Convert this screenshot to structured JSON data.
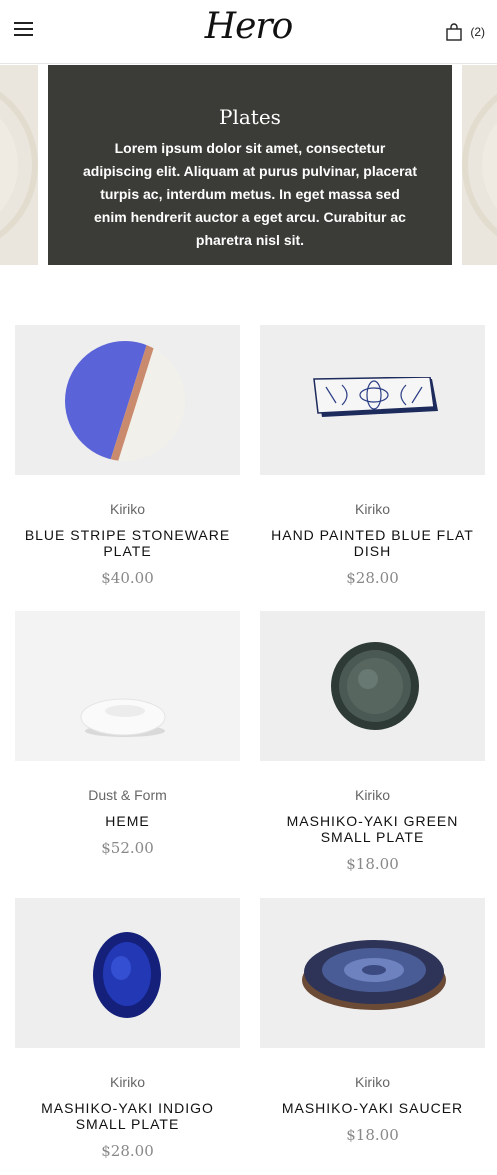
{
  "header": {
    "logo": "Hero",
    "cart_count": "(2)"
  },
  "banner": {
    "title": "Plates",
    "text": "Lorem ipsum dolor sit amet, consectetur adipiscing elit. Aliquam at purus pulvinar, placerat turpis ac, interdum metus. In eget massa sed enim hendrerit auctor a eget arcu. Curabitur ac pharetra nisl sit."
  },
  "products": [
    {
      "vendor": "Kiriko",
      "name": "Blue Stripe Stoneware Plate",
      "price": "$40.00"
    },
    {
      "vendor": "Kiriko",
      "name": "Hand Painted Blue Flat Dish",
      "price": "$28.00"
    },
    {
      "vendor": "Dust & Form",
      "name": "Heme",
      "price": "$52.00"
    },
    {
      "vendor": "Kiriko",
      "name": "Mashiko-Yaki Green Small Plate",
      "price": "$18.00"
    },
    {
      "vendor": "Kiriko",
      "name": "Mashiko-Yaki Indigo Small Plate",
      "price": "$28.00"
    },
    {
      "vendor": "Kiriko",
      "name": "Mashiko-Yaki Saucer",
      "price": "$18.00"
    }
  ]
}
